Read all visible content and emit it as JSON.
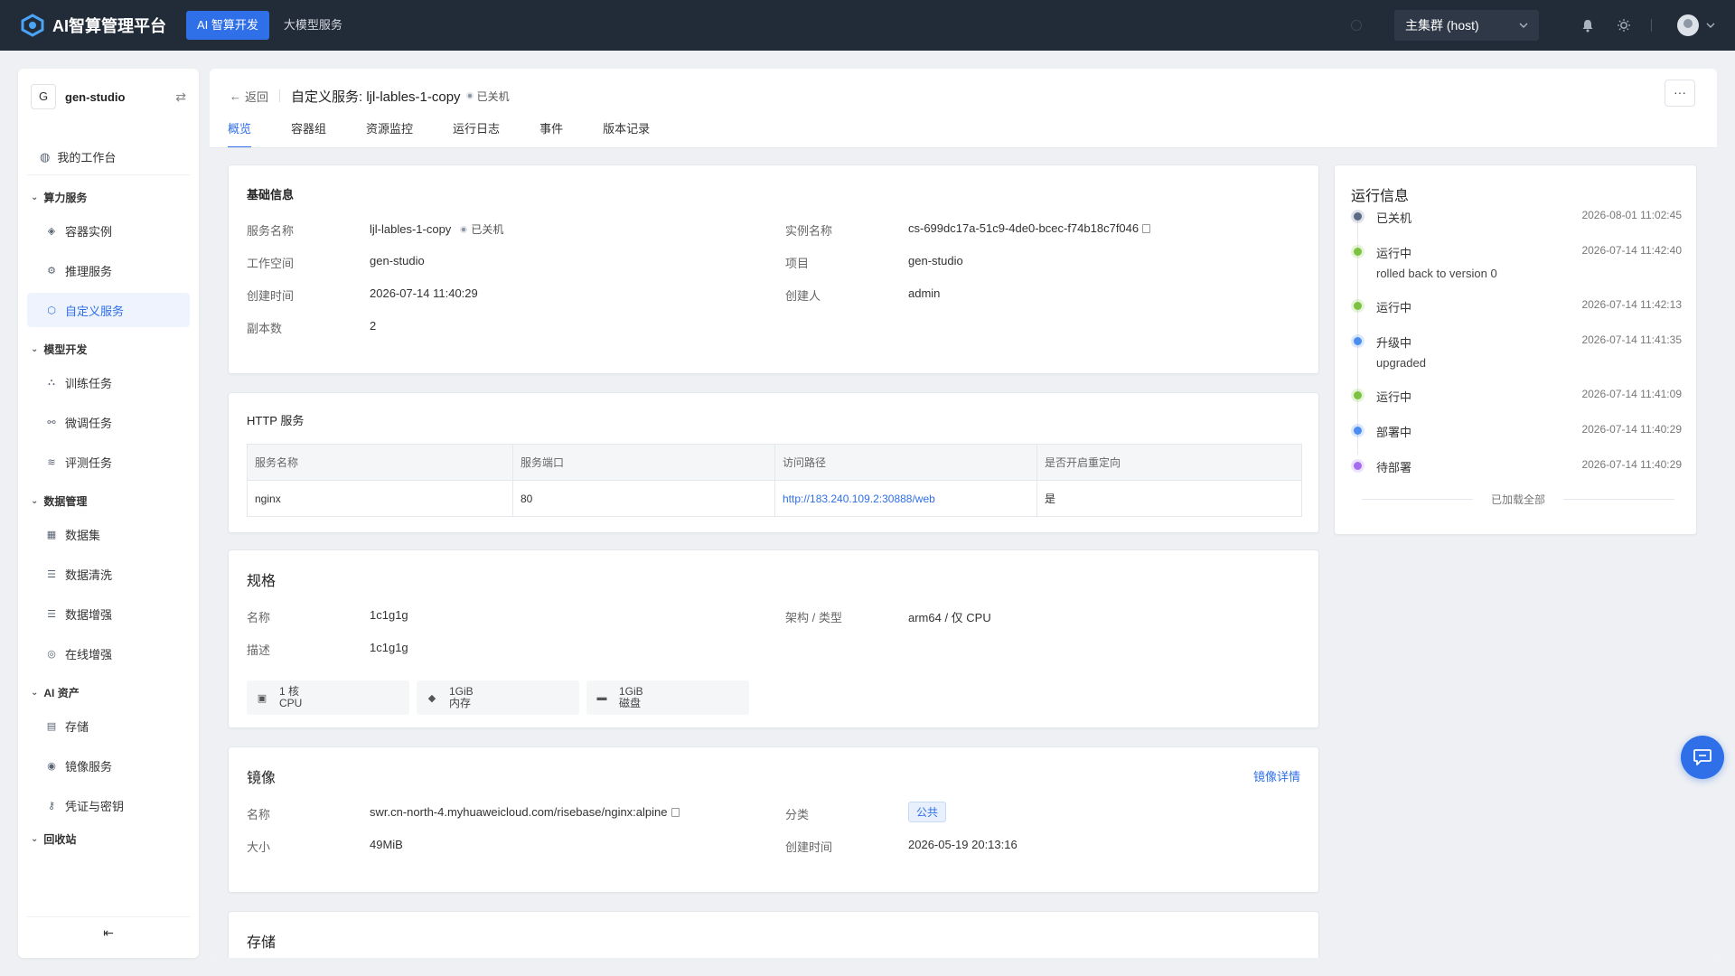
{
  "topbar": {
    "logo_text": "AI智算管理平台",
    "nav": [
      {
        "label": "AI 智算开发",
        "active": true
      },
      {
        "label": "大模型服务",
        "active": false
      }
    ],
    "cluster": "主集群 (host)",
    "icons": [
      "search-icon",
      "bell-icon",
      "theme-icon",
      "avatar",
      "chevron-down-icon"
    ]
  },
  "sidebar": {
    "workspace_badge": "G",
    "workspace_name": "gen-studio",
    "home": "我的工作台",
    "groups": [
      {
        "label": "算力服务",
        "items": [
          "容器实例",
          "推理服务",
          "自定义服务"
        ]
      },
      {
        "label": "模型开发",
        "items": [
          "训练任务",
          "微调任务",
          "评测任务"
        ]
      },
      {
        "label": "数据管理",
        "items": [
          "数据集",
          "数据清洗",
          "数据增强",
          "在线增强"
        ]
      },
      {
        "label": "AI 资产",
        "items": [
          "存储",
          "镜像服务",
          "凭证与密钥"
        ]
      },
      {
        "label": "回收站",
        "items": []
      }
    ],
    "active_item": "自定义服务",
    "collapse_icon": "collapse-left-icon"
  },
  "header": {
    "back": "返回",
    "title": "自定义服务: ljl-lables-1-copy",
    "status": "已关机",
    "more": "···",
    "tabs": [
      "概览",
      "容器组",
      "资源监控",
      "运行日志",
      "事件",
      "版本记录"
    ],
    "active_tab": "概览"
  },
  "basic": {
    "title": "基础信息",
    "fields": {
      "service_name_label": "服务名称",
      "service_name": "ljl-lables-1-copy",
      "service_status": "已关机",
      "instance_label": "实例名称",
      "instance": "cs-699dc17a-51c9-4de0-bcec-f74b18c7f046",
      "workspace_label": "工作空间",
      "workspace": "gen-studio",
      "project_label": "项目",
      "project": "gen-studio",
      "created_label": "创建时间",
      "created": "2026-07-14 11:40:29",
      "creator_label": "创建人",
      "creator": "admin",
      "replicas_label": "副本数",
      "replicas": "2"
    }
  },
  "http": {
    "title": "HTTP 服务",
    "columns": [
      "服务名称",
      "服务端口",
      "访问路径",
      "是否开启重定向"
    ],
    "rows": [
      [
        "nginx",
        "80",
        "http://183.240.109.2:30888/web",
        "是"
      ]
    ]
  },
  "spec": {
    "title": "规格",
    "name_label": "名称",
    "name": "1c1g1g",
    "arch_label": "架构 / 类型",
    "arch": "arm64 / 仅 CPU",
    "desc_label": "描述",
    "desc": "1c1g1g",
    "chips": [
      {
        "value": "1 核",
        "unit": "CPU",
        "icon": "cpu-icon"
      },
      {
        "value": "1GiB",
        "unit": "内存",
        "icon": "memory-icon"
      },
      {
        "value": "1GiB",
        "unit": "磁盘",
        "icon": "disk-icon"
      }
    ]
  },
  "image": {
    "title": "镜像",
    "detail_link": "镜像详情",
    "name_label": "名称",
    "name": "swr.cn-north-4.myhuaweicloud.com/risebase/nginx:alpine",
    "category_label": "分类",
    "category": "公共",
    "size_label": "大小",
    "size": "49MiB",
    "created_label": "创建时间",
    "created": "2026-05-19 20:13:16"
  },
  "storage": {
    "title": "存储"
  },
  "runtime": {
    "title": "运行信息",
    "events": [
      {
        "status": "已关机",
        "time": "2026-08-01 11:02:45",
        "msg": "",
        "color": "#5b6b85"
      },
      {
        "status": "运行中",
        "time": "2026-07-14 11:42:40",
        "msg": "rolled back to version 0",
        "color": "#7cc241"
      },
      {
        "status": "运行中",
        "time": "2026-07-14 11:42:13",
        "msg": "",
        "color": "#7cc241"
      },
      {
        "status": "升级中",
        "time": "2026-07-14 11:41:35",
        "msg": "upgraded",
        "color": "#4a8cf0"
      },
      {
        "status": "运行中",
        "time": "2026-07-14 11:41:09",
        "msg": "",
        "color": "#7cc241"
      },
      {
        "status": "部署中",
        "time": "2026-07-14 11:40:29",
        "msg": "",
        "color": "#4a8cf0"
      },
      {
        "status": "待部署",
        "time": "2026-07-14 11:40:29",
        "msg": "",
        "color": "#a66cf0"
      }
    ],
    "loaded_all": "已加载全部"
  },
  "fab_icon": "chat-icon"
}
